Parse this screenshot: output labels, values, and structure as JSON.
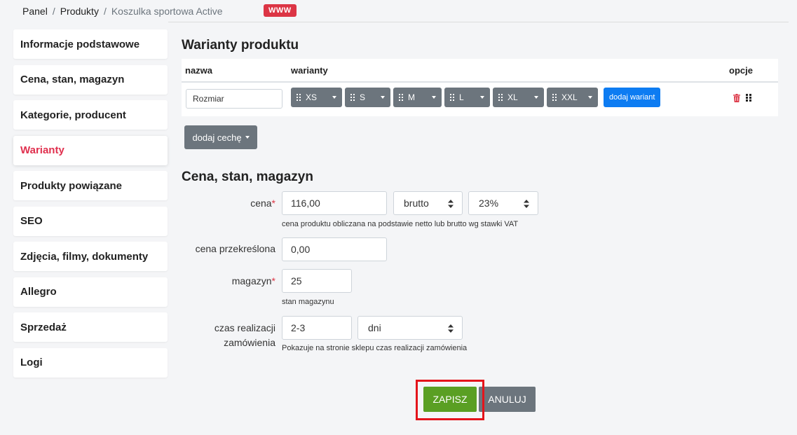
{
  "breadcrumb": {
    "items": [
      "Panel",
      "Produkty",
      "Koszulka sportowa Active"
    ],
    "separator": "/",
    "badge": "WWW"
  },
  "sidebar": {
    "items": [
      {
        "label": "Informacje podstawowe",
        "active": false
      },
      {
        "label": "Cena, stan, magazyn",
        "active": false
      },
      {
        "label": "Kategorie, producent",
        "active": false
      },
      {
        "label": "Warianty",
        "active": true
      },
      {
        "label": "Produkty powiązane",
        "active": false
      },
      {
        "label": "SEO",
        "active": false
      },
      {
        "label": "Zdjęcia, filmy, dokumenty",
        "active": false
      },
      {
        "label": "Allegro",
        "active": false
      },
      {
        "label": "Sprzedaż",
        "active": false
      },
      {
        "label": "Logi",
        "active": false
      }
    ],
    "active_color": "#e0304e"
  },
  "variants": {
    "title": "Warianty produktu",
    "headers": {
      "nazwa": "nazwa",
      "warianty": "warianty",
      "opcje": "opcje"
    },
    "feature_name": "Rozmiar",
    "chips": [
      "XS",
      "S",
      "M",
      "L",
      "XL",
      "XXL"
    ],
    "add_variant": "dodaj wariant",
    "add_feature": "dodaj cechę"
  },
  "price": {
    "title": "Cena, stan, magazyn",
    "price_label": "cena",
    "price_value": "116,00",
    "price_type": "brutto",
    "vat": "23%",
    "price_help": "cena produktu obliczana na podstawie netto lub brutto wg stawki VAT",
    "strike_label": "cena przekreślona",
    "strike_value": "0,00",
    "stock_label": "magazyn",
    "stock_value": "25",
    "stock_help": "stan magazynu",
    "lead_label_1": "czas realizacji",
    "lead_label_2": "zamówienia",
    "lead_value": "2-3",
    "lead_unit": "dni",
    "lead_help": "Pokazuje na stronie sklepu czas realizacji zamówienia",
    "required_mark": "*"
  },
  "actions": {
    "save": "ZAPISZ",
    "cancel": "ANULUJ"
  },
  "colors": {
    "save_green": "#5a9f23",
    "cancel_gray": "#6c757d",
    "primary_blue": "#0d7cf2",
    "danger_red": "#dc3545",
    "highlight_red": "#e4141b"
  }
}
